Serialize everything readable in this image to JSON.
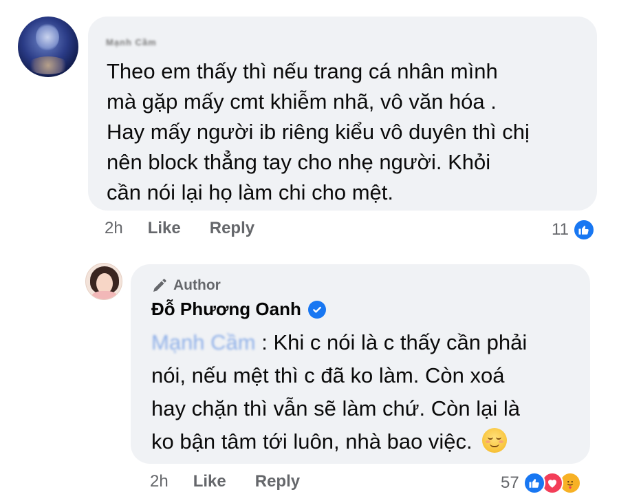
{
  "comment": {
    "author_name": "Mạnh Cầm",
    "lines": [
      "Theo em thấy thì nếu trang cá nhân mình",
      "mà gặp mấy cmt khiễm nhã, vô văn hóa .",
      "Hay mấy người ib riêng kiểu vô duyên thì chị",
      "nên block thẳng tay cho nhẹ người. Khỏi",
      "cần nói lại họ làm chi cho mệt."
    ],
    "time": "2h",
    "like_label": "Like",
    "reply_label": "Reply",
    "reaction_count": "11",
    "reactions": [
      "like-icon"
    ]
  },
  "reply": {
    "badge": "Author",
    "author_name": "Đỗ Phương Oanh",
    "mention": "Mạnh Cầm",
    "lines": [
      ": Khi c nói là c thấy cần phải",
      "nói, nếu mệt thì c đã ko làm. Còn xoá",
      "hay chặn thì vẫn sẽ làm chứ. Còn lại là",
      "ko bận tâm tới luôn, nhà bao việc."
    ],
    "time": "2h",
    "like_label": "Like",
    "reply_label": "Reply",
    "reaction_count": "57",
    "reactions": [
      "like-icon",
      "love-icon",
      "care-icon"
    ]
  },
  "colors": {
    "bubble": "#f0f2f5",
    "meta_text": "#65676b",
    "like_blue": "#1877f2",
    "love_red": "#f33e58",
    "care_yellow": "#f7b125"
  }
}
